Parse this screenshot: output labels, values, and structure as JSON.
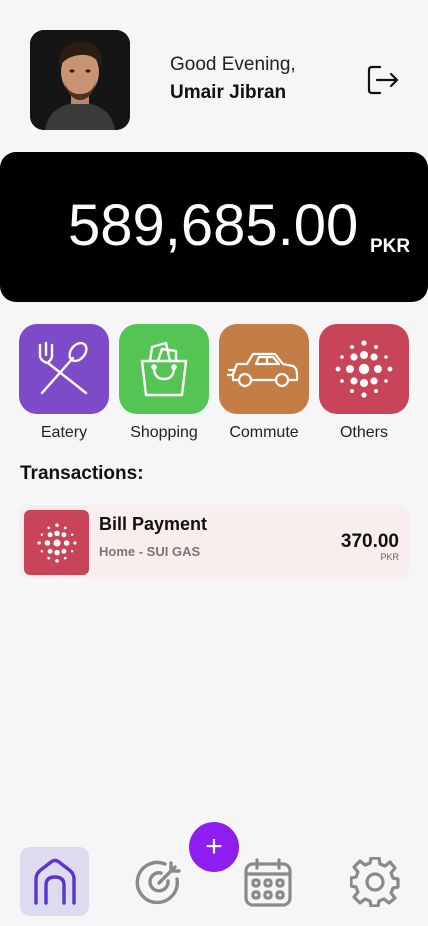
{
  "header": {
    "greeting": "Good Evening,",
    "username": "Umair Jibran",
    "logout_icon": "logout-icon"
  },
  "balance": {
    "amount": "589,685.00",
    "currency": "PKR"
  },
  "categories": [
    {
      "label": "Eatery",
      "icon": "fork-spoon-icon",
      "color": "#7e4bc8"
    },
    {
      "label": "Shopping",
      "icon": "shopping-bag-icon",
      "color": "#54c454"
    },
    {
      "label": "Commute",
      "icon": "car-icon",
      "color": "#c47d45"
    },
    {
      "label": "Others",
      "icon": "dots-icon",
      "color": "#c84458"
    }
  ],
  "transactions": {
    "title": "Transactions:",
    "items": [
      {
        "name": "Bill Payment",
        "sub": "Home - SUI GAS",
        "amount": "370.00",
        "currency": "PKR",
        "icon": "dots-icon",
        "color": "#c84458"
      }
    ]
  },
  "navbar": {
    "items": [
      "home-icon",
      "target-icon",
      "calendar-icon",
      "settings-icon"
    ],
    "fab": "+",
    "accent": "#8e1ef0"
  }
}
